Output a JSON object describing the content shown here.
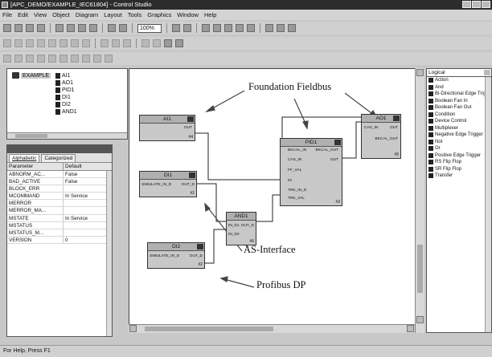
{
  "window": {
    "title": "[APC_DEMO/EXAMPLE_IEC61804] - Control Studio"
  },
  "menu": [
    "File",
    "Edit",
    "View",
    "Object",
    "Diagram",
    "Layout",
    "Tools",
    "Graphics",
    "Window",
    "Help"
  ],
  "toolbar": {
    "zoom": "100%"
  },
  "tree": {
    "root": "EXAMPLE",
    "items": [
      "AI1",
      "AO1",
      "PID1",
      "DI1",
      "DI2",
      "AND1"
    ]
  },
  "properties": {
    "tabs": [
      "Alphabetic",
      "Categorized"
    ],
    "headers": [
      "Parameter",
      "Default"
    ],
    "rows": [
      [
        "ABNORM_AC...",
        "False"
      ],
      [
        "BAD_ACTIVE",
        "False"
      ],
      [
        "BLOCK_ERR",
        ""
      ],
      [
        "MCOMMAND",
        "In Service"
      ],
      [
        "MERROR",
        ""
      ],
      [
        "MERROR_MA...",
        ""
      ],
      [
        "MSTATE",
        "In Service"
      ],
      [
        "MSTATUS",
        ""
      ],
      [
        "MSTATUS_M...",
        ""
      ],
      [
        "VERSION",
        "0"
      ]
    ]
  },
  "blocks": {
    "ai1": {
      "name": "AI1",
      "out": "OUT",
      "num": "#4"
    },
    "pid1": {
      "name": "PID1",
      "pins": [
        "BKCAL_IN",
        "BKCAL_OUT",
        "CAS_IN",
        "OUT",
        "FF_VAL",
        "IN",
        "TRK_IN_D",
        "TRK_VAL"
      ],
      "num": "#3"
    },
    "ao1": {
      "name": "AO1",
      "pins": [
        "CAS_IN",
        "OUT",
        "BKCAL_OUT"
      ],
      "num": "#5"
    },
    "di1": {
      "name": "DI1",
      "pins": [
        "SIMULATE_IN_D",
        "OUT_D"
      ],
      "num": "#1"
    },
    "and1": {
      "name": "AND1",
      "pins": [
        "IN_D1",
        "OUT_D",
        "IN_D2"
      ],
      "num": "#6"
    },
    "di2": {
      "name": "DI2",
      "pins": [
        "SIMULATE_IN_D",
        "OUT_D"
      ],
      "num": "#2"
    }
  },
  "annotations": {
    "foundation": "Foundation Fieldbus",
    "asi": "AS-Interface",
    "profibus": "Profibus DP"
  },
  "palette": {
    "dropdown": "Logical",
    "items": [
      "Action",
      "And",
      "Bi-Directional Edge Trigg",
      "Boolean Fan In",
      "Boolean Fan Out",
      "Condition",
      "Device Control",
      "Multiplexer",
      "Negative Edge Trigger",
      "Not",
      "Or",
      "Positive Edge Trigger",
      "RS Flip Flop",
      "SR Flip Flop",
      "Transfer"
    ]
  },
  "status": {
    "text": "For Help, Press F1"
  }
}
